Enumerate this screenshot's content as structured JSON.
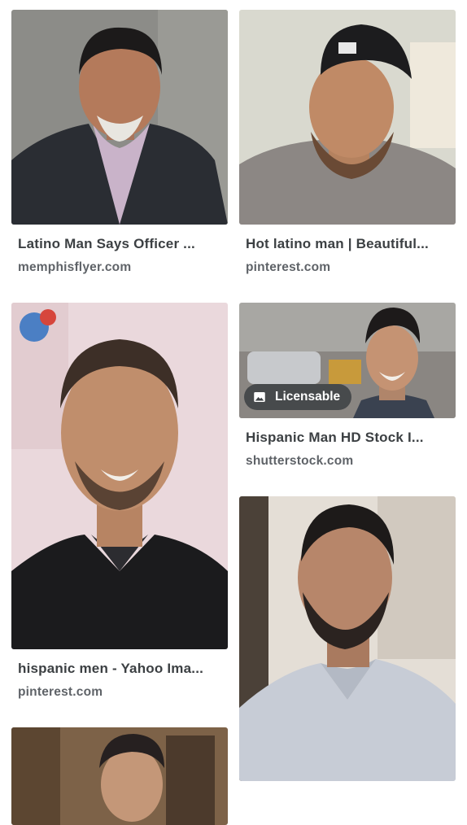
{
  "results": {
    "left": [
      {
        "title": "Latino Man Says Officer ...",
        "source": "memphisflyer.com",
        "licensable": false
      },
      {
        "title": "hispanic men - Yahoo Ima...",
        "source": "pinterest.com",
        "licensable": false
      },
      {
        "title": "",
        "source": "",
        "licensable": false
      }
    ],
    "right": [
      {
        "title": "Hot latino man | Beautiful...",
        "source": "pinterest.com",
        "licensable": false
      },
      {
        "title": "Hispanic Man HD Stock I...",
        "source": "shutterstock.com",
        "licensable": true,
        "badge_label": "Licensable"
      },
      {
        "title": "",
        "source": "",
        "licensable": false
      }
    ]
  },
  "colors": {
    "title_text": "#3c4043",
    "source_text": "#5f6368",
    "badge_bg": "#3c4043"
  },
  "icons": {
    "licensable": "image-icon"
  }
}
